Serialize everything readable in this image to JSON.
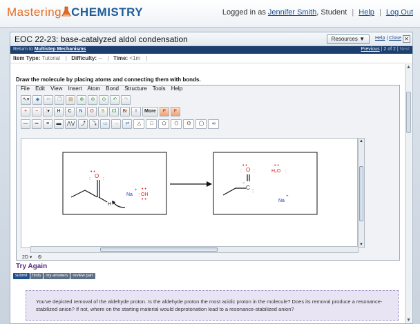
{
  "header": {
    "logo_part1": "Mastering",
    "logo_part2": "CHEMISTRY",
    "logged_in_text": "Logged in as",
    "user_name": "Jennifer Smith",
    "user_role": ", Student",
    "help": "Help",
    "logout": "Log Out"
  },
  "panel": {
    "title": "EOC 22-23: base-catalyzed aldol condensation",
    "resources_label": "Resources ▼",
    "help_link": "Help",
    "close_link": "Close",
    "close_x": "✕",
    "back_prefix": "Return to",
    "back_link": "Multistep Mechanisms",
    "previous": "Previous",
    "page_indicator": "2 of 2",
    "next": "Next"
  },
  "meta": {
    "item_type_label": "Item Type:",
    "item_type": "Tutorial",
    "difficulty_label": "Difficulty:",
    "difficulty": "--",
    "time_label": "Time:",
    "time": "<1m"
  },
  "instructions": "Draw the molecule by placing atoms and connecting them with bonds.",
  "editor": {
    "menus": [
      "File",
      "Edit",
      "View",
      "Insert",
      "Atom",
      "Bond",
      "Structure",
      "Tools",
      "Help"
    ],
    "elements": [
      "H",
      "C",
      "N",
      "O",
      "S",
      "Cl",
      "Br",
      "I"
    ],
    "more": "More",
    "extra_buttons": [
      "P",
      "F"
    ],
    "status_mode": "2D"
  },
  "canvas": {
    "left_box": {
      "oxygen": "O",
      "hydrogen": "H",
      "sodium": "Na",
      "hydroxide": "OH"
    },
    "right_box": {
      "oxygen": "O",
      "carbon": "C",
      "water": "H₂O",
      "sodium": "Na",
      "plus": "+"
    }
  },
  "try_again": "Try Again",
  "actions": [
    "submit",
    "hints",
    "my answers",
    "review part"
  ],
  "feedback": "You've depicted removal of the aldehyde proton. Is the aldehyde proton the most acidic proton in the molecule? Does its removal produce a resonance-stabilized anion? If not, where on the starting material would deprotonation lead to a resonance-stabilized anion?",
  "colors": {
    "brand_orange": "#e86a1e",
    "brand_blue": "#1f5c99",
    "nav_dark": "#1d3f6e",
    "oxygen_red": "#d22",
    "nitrogen_blue": "#1a3fc4"
  }
}
